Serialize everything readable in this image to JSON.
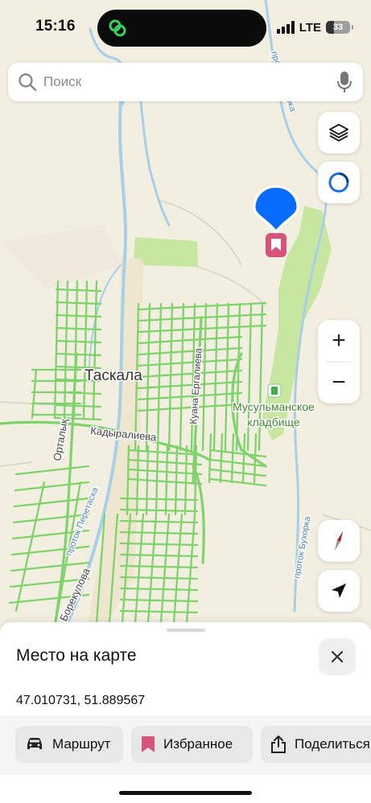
{
  "status_bar": {
    "time": "15:16",
    "network": "LTE",
    "battery": "33",
    "battery_level": 0.33
  },
  "search": {
    "placeholder": "Поиск"
  },
  "map": {
    "town_label": "Таскала",
    "cemetery_label_line1": "Мусульманское",
    "cemetery_label_line2": "кладбище",
    "street_kadyralieva": "Кадыралиева",
    "street_kuana": "Куана Ергалиева",
    "street_ortalyk": "Орталық",
    "street_borekulova": "Борекулова",
    "river_peretaska": "проток Перетаска",
    "river_bukhorka_top": "проток Бухорка",
    "river_bukhorka_bottom": "проток Бухорка",
    "colors": {
      "background": "#f2eee0",
      "roads": "#7ed36a",
      "water": "#a8cfe9",
      "park": "#c7e6a0",
      "pin": "#0a6cff",
      "bookmark": "#d9547a"
    }
  },
  "controls": {
    "layers_icon": "layers-icon",
    "location_icon": "location-ring-icon",
    "zoom_in": "+",
    "zoom_out": "−",
    "compass_icon": "compass-icon",
    "navigate_icon": "navigation-arrow-icon"
  },
  "sheet": {
    "title": "Место на карте",
    "coordinates": "47.010731, 51.889567",
    "actions": [
      {
        "label": "Маршрут",
        "icon": "car-icon"
      },
      {
        "label": "Избранное",
        "icon": "bookmark-icon"
      },
      {
        "label": "Поделиться",
        "icon": "share-icon"
      }
    ]
  }
}
